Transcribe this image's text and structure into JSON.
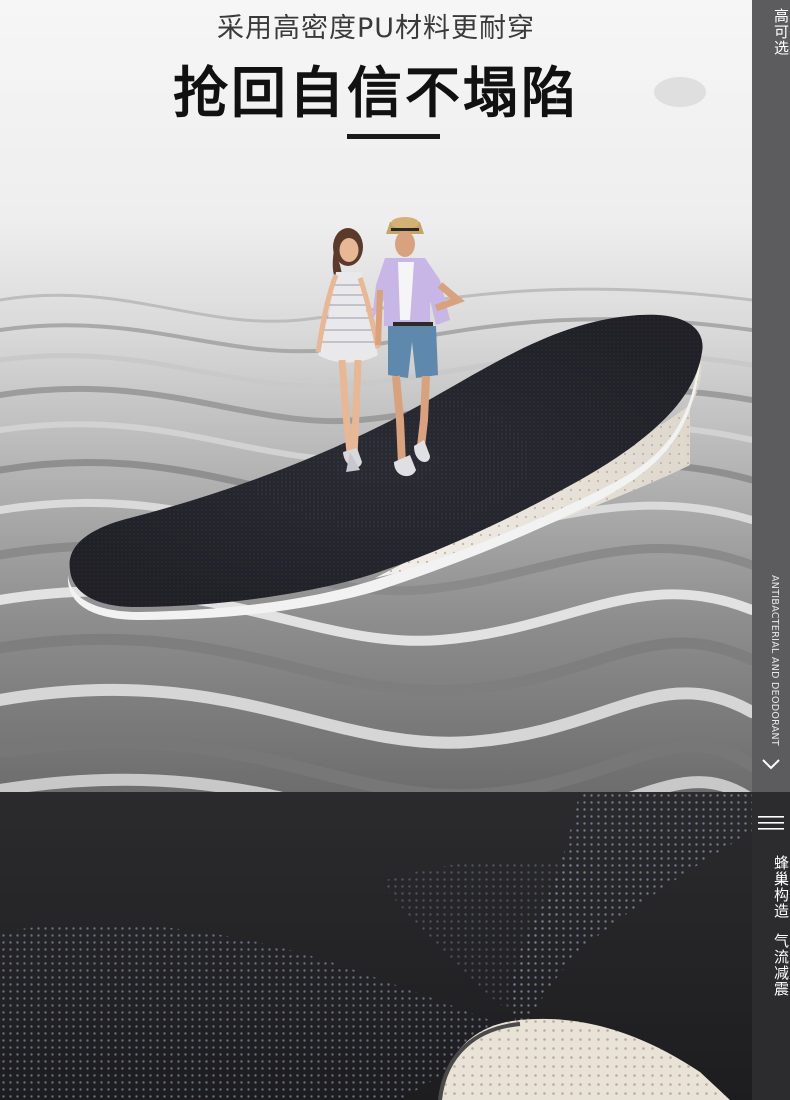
{
  "hero": {
    "subtitle": "采用高密度PU材料更耐穿",
    "title": "抢回自信不塌陷"
  },
  "rail": {
    "top_label": "高可选",
    "english_label": "ANTIBACTERIAL AND DEODORANT",
    "bottom_label_1": "蜂巢构造",
    "bottom_label_2": "气流减震"
  },
  "icons": {
    "chevron": "chevron-down-icon",
    "menu": "hamburger-menu-icon"
  },
  "colors": {
    "insole_top": "#2b2b33",
    "insole_foam": "#e9e4dc",
    "rail": "#5c5c5e",
    "dark_bg": "#232325",
    "dot_blue": "#7d86a8"
  }
}
